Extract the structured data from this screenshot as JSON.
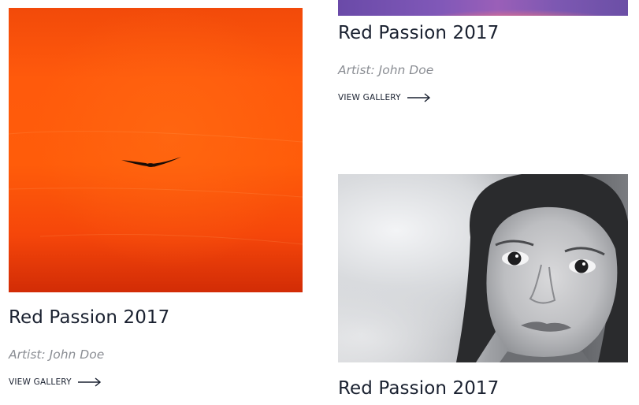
{
  "cards": [
    {
      "id": "left",
      "image_description_icon": "orange-sunset-bird-image",
      "title": "Red Passion 2017",
      "artist": "Artist: John Doe",
      "view_label": "VIEW GALLERY"
    },
    {
      "id": "right-top",
      "image_description_icon": "purple-sunset-image",
      "title": "Red Passion 2017",
      "artist": "Artist: John Doe",
      "view_label": "VIEW GALLERY"
    },
    {
      "id": "right-bottom",
      "image_description_icon": "child-portrait-image",
      "title": "Red Passion 2017"
    }
  ],
  "colors": {
    "title": "#1a2130",
    "artist": "#8a8d93",
    "accent_orange": "#ff5a0c",
    "accent_purple": "#8058b8"
  }
}
